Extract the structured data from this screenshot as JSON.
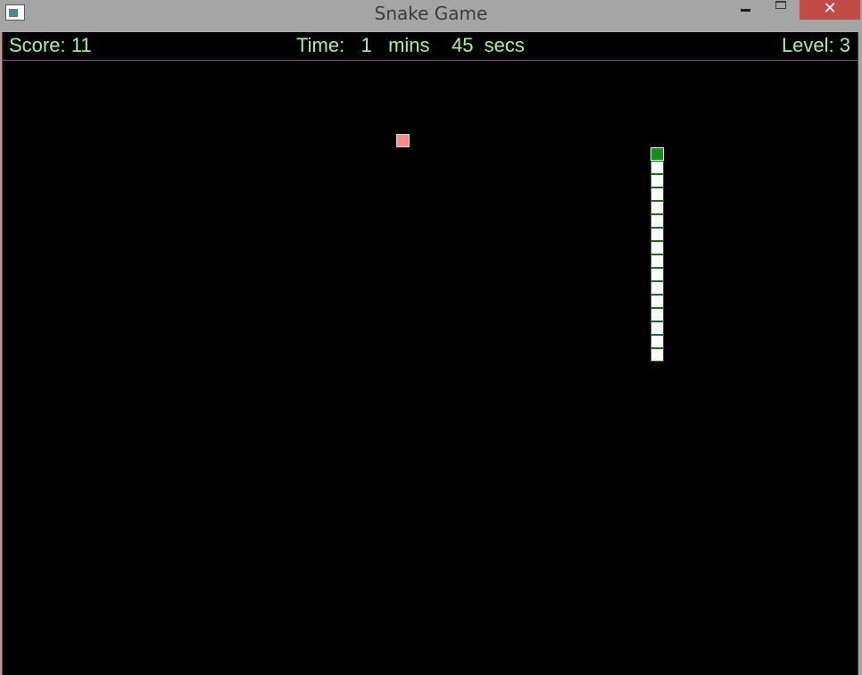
{
  "window": {
    "title": "Snake Game",
    "close_glyph": "✕"
  },
  "hud": {
    "score": "Score: 11",
    "time": "Time:   1   mins    45  secs",
    "level": "Level: 3"
  },
  "game": {
    "colors": {
      "background": "#000000",
      "hud_text": "#a8f0a0",
      "hud_border": "#d13a3a",
      "snake_head": "#1b8a1b",
      "snake_body": "#ffffff",
      "food": "#ff8a8a"
    },
    "snake_length": 16
  }
}
